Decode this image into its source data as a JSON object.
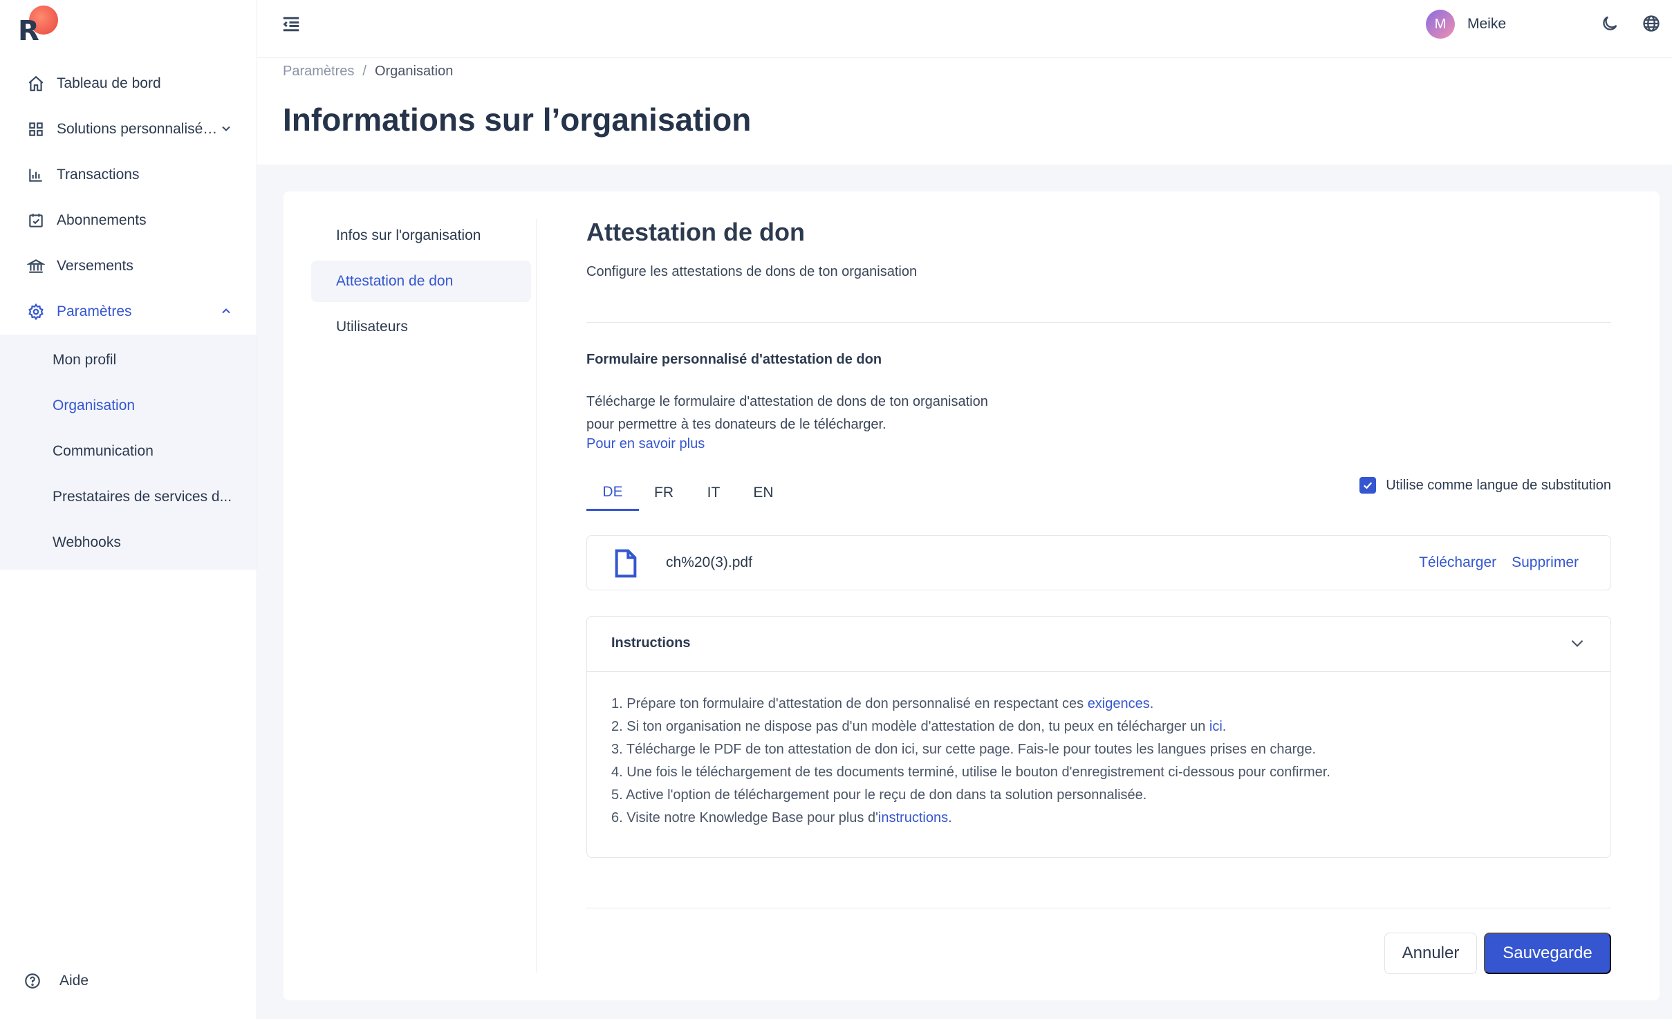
{
  "brand": {
    "logo_letter": "R"
  },
  "sidebar": {
    "items": [
      {
        "label": "Tableau de bord",
        "icon": "home-icon"
      },
      {
        "label": "Solutions personnalisé…",
        "icon": "grid-icon"
      },
      {
        "label": "Transactions",
        "icon": "bar-chart-icon"
      },
      {
        "label": "Abonnements",
        "icon": "calendar-check-icon"
      },
      {
        "label": "Versements",
        "icon": "bank-icon"
      },
      {
        "label": "Paramètres",
        "icon": "gear-icon"
      }
    ],
    "sub_items": [
      {
        "label": "Mon profil"
      },
      {
        "label": "Organisation"
      },
      {
        "label": "Communication"
      },
      {
        "label": "Prestataires de services d..."
      },
      {
        "label": "Webhooks"
      }
    ],
    "help_label": "Aide"
  },
  "topbar": {
    "avatar_initial": "M",
    "user_name": "Meike"
  },
  "breadcrumb": {
    "root": "Paramètres",
    "separator": "/",
    "current": "Organisation"
  },
  "page_title": "Informations sur l’organisation",
  "settings_nav": [
    {
      "label": "Infos sur l'organisation"
    },
    {
      "label": "Attestation de don"
    },
    {
      "label": "Utilisateurs"
    }
  ],
  "section": {
    "title": "Attestation de don",
    "description": "Configure les attestations de dons de ton organisation",
    "form_title": "Formulaire personnalisé d'attestation de don",
    "form_description": "Télécharge le formulaire d'attestation de dons de ton organisation pour permettre à tes donateurs de le télécharger.",
    "learn_more": "Pour en savoir plus"
  },
  "language_tabs": [
    "DE",
    "FR",
    "IT",
    "EN"
  ],
  "active_language": "DE",
  "fallback": {
    "label": "Utilise comme langue de substitution",
    "checked": true
  },
  "file": {
    "name": "ch%20(3).pdf",
    "download_label": "Télécharger",
    "delete_label": "Supprimer"
  },
  "instructions": {
    "title": "Instructions",
    "steps": [
      {
        "prefix": "1. Prépare ton formulaire d'attestation de don personnalisé en respectant ces ",
        "link": "exigences",
        "suffix": "."
      },
      {
        "prefix": "2. Si ton organisation ne dispose pas d'un modèle d'attestation de don, tu peux en télécharger un ",
        "link": "ici",
        "suffix": "."
      },
      {
        "prefix": "3. Télécharge le PDF de ton attestation de don ici, sur cette page. Fais-le pour toutes les langues prises en charge.",
        "link": "",
        "suffix": ""
      },
      {
        "prefix": "4. Une fois le téléchargement de tes documents terminé, utilise le bouton d'enregistrement ci-dessous pour confirmer.",
        "link": "",
        "suffix": ""
      },
      {
        "prefix": "5. Active l'option de téléchargement pour le reçu de don dans ta solution personnalisée.",
        "link": "",
        "suffix": ""
      },
      {
        "prefix": "6. Visite notre Knowledge Base pour plus d'",
        "link": "instructions",
        "suffix": "."
      }
    ]
  },
  "buttons": {
    "cancel": "Annuler",
    "save": "Sauvegarde"
  },
  "colors": {
    "accent": "#3556d0",
    "text": "#2c3a4f",
    "page_bg": "#f5f6fa",
    "logo_dot": "#e8453c"
  }
}
